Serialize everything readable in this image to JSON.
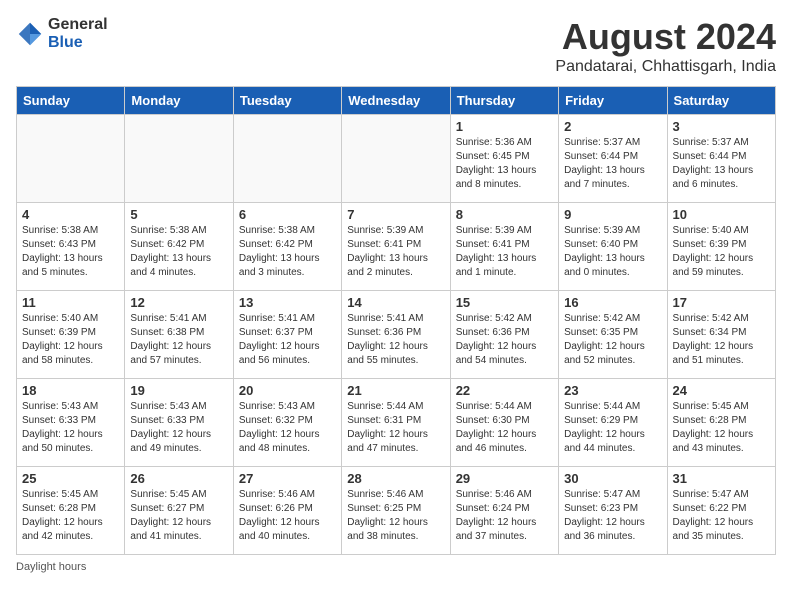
{
  "header": {
    "logo_general": "General",
    "logo_blue": "Blue",
    "title": "August 2024",
    "subtitle": "Pandatarai, Chhattisgarh, India"
  },
  "days_of_week": [
    "Sunday",
    "Monday",
    "Tuesday",
    "Wednesday",
    "Thursday",
    "Friday",
    "Saturday"
  ],
  "weeks": [
    [
      {
        "day": "",
        "info": ""
      },
      {
        "day": "",
        "info": ""
      },
      {
        "day": "",
        "info": ""
      },
      {
        "day": "",
        "info": ""
      },
      {
        "day": "1",
        "info": "Sunrise: 5:36 AM\nSunset: 6:45 PM\nDaylight: 13 hours\nand 8 minutes."
      },
      {
        "day": "2",
        "info": "Sunrise: 5:37 AM\nSunset: 6:44 PM\nDaylight: 13 hours\nand 7 minutes."
      },
      {
        "day": "3",
        "info": "Sunrise: 5:37 AM\nSunset: 6:44 PM\nDaylight: 13 hours\nand 6 minutes."
      }
    ],
    [
      {
        "day": "4",
        "info": "Sunrise: 5:38 AM\nSunset: 6:43 PM\nDaylight: 13 hours\nand 5 minutes."
      },
      {
        "day": "5",
        "info": "Sunrise: 5:38 AM\nSunset: 6:42 PM\nDaylight: 13 hours\nand 4 minutes."
      },
      {
        "day": "6",
        "info": "Sunrise: 5:38 AM\nSunset: 6:42 PM\nDaylight: 13 hours\nand 3 minutes."
      },
      {
        "day": "7",
        "info": "Sunrise: 5:39 AM\nSunset: 6:41 PM\nDaylight: 13 hours\nand 2 minutes."
      },
      {
        "day": "8",
        "info": "Sunrise: 5:39 AM\nSunset: 6:41 PM\nDaylight: 13 hours\nand 1 minute."
      },
      {
        "day": "9",
        "info": "Sunrise: 5:39 AM\nSunset: 6:40 PM\nDaylight: 13 hours\nand 0 minutes."
      },
      {
        "day": "10",
        "info": "Sunrise: 5:40 AM\nSunset: 6:39 PM\nDaylight: 12 hours\nand 59 minutes."
      }
    ],
    [
      {
        "day": "11",
        "info": "Sunrise: 5:40 AM\nSunset: 6:39 PM\nDaylight: 12 hours\nand 58 minutes."
      },
      {
        "day": "12",
        "info": "Sunrise: 5:41 AM\nSunset: 6:38 PM\nDaylight: 12 hours\nand 57 minutes."
      },
      {
        "day": "13",
        "info": "Sunrise: 5:41 AM\nSunset: 6:37 PM\nDaylight: 12 hours\nand 56 minutes."
      },
      {
        "day": "14",
        "info": "Sunrise: 5:41 AM\nSunset: 6:36 PM\nDaylight: 12 hours\nand 55 minutes."
      },
      {
        "day": "15",
        "info": "Sunrise: 5:42 AM\nSunset: 6:36 PM\nDaylight: 12 hours\nand 54 minutes."
      },
      {
        "day": "16",
        "info": "Sunrise: 5:42 AM\nSunset: 6:35 PM\nDaylight: 12 hours\nand 52 minutes."
      },
      {
        "day": "17",
        "info": "Sunrise: 5:42 AM\nSunset: 6:34 PM\nDaylight: 12 hours\nand 51 minutes."
      }
    ],
    [
      {
        "day": "18",
        "info": "Sunrise: 5:43 AM\nSunset: 6:33 PM\nDaylight: 12 hours\nand 50 minutes."
      },
      {
        "day": "19",
        "info": "Sunrise: 5:43 AM\nSunset: 6:33 PM\nDaylight: 12 hours\nand 49 minutes."
      },
      {
        "day": "20",
        "info": "Sunrise: 5:43 AM\nSunset: 6:32 PM\nDaylight: 12 hours\nand 48 minutes."
      },
      {
        "day": "21",
        "info": "Sunrise: 5:44 AM\nSunset: 6:31 PM\nDaylight: 12 hours\nand 47 minutes."
      },
      {
        "day": "22",
        "info": "Sunrise: 5:44 AM\nSunset: 6:30 PM\nDaylight: 12 hours\nand 46 minutes."
      },
      {
        "day": "23",
        "info": "Sunrise: 5:44 AM\nSunset: 6:29 PM\nDaylight: 12 hours\nand 44 minutes."
      },
      {
        "day": "24",
        "info": "Sunrise: 5:45 AM\nSunset: 6:28 PM\nDaylight: 12 hours\nand 43 minutes."
      }
    ],
    [
      {
        "day": "25",
        "info": "Sunrise: 5:45 AM\nSunset: 6:28 PM\nDaylight: 12 hours\nand 42 minutes."
      },
      {
        "day": "26",
        "info": "Sunrise: 5:45 AM\nSunset: 6:27 PM\nDaylight: 12 hours\nand 41 minutes."
      },
      {
        "day": "27",
        "info": "Sunrise: 5:46 AM\nSunset: 6:26 PM\nDaylight: 12 hours\nand 40 minutes."
      },
      {
        "day": "28",
        "info": "Sunrise: 5:46 AM\nSunset: 6:25 PM\nDaylight: 12 hours\nand 38 minutes."
      },
      {
        "day": "29",
        "info": "Sunrise: 5:46 AM\nSunset: 6:24 PM\nDaylight: 12 hours\nand 37 minutes."
      },
      {
        "day": "30",
        "info": "Sunrise: 5:47 AM\nSunset: 6:23 PM\nDaylight: 12 hours\nand 36 minutes."
      },
      {
        "day": "31",
        "info": "Sunrise: 5:47 AM\nSunset: 6:22 PM\nDaylight: 12 hours\nand 35 minutes."
      }
    ]
  ],
  "footer": {
    "note": "Daylight hours"
  }
}
